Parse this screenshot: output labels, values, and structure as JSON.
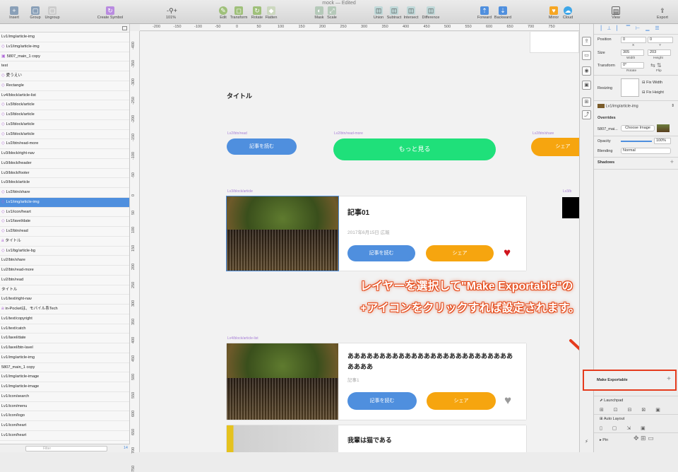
{
  "window": {
    "title": "mock",
    "status": "— Edited"
  },
  "toolbar": {
    "insert": "Insert",
    "group": "Group",
    "ungroup": "Ungroup",
    "create_symbol": "Create Symbol",
    "zoom": "101%",
    "edit": "Edit",
    "transform": "Transform",
    "rotate": "Rotate",
    "flatten": "Flatten",
    "mask": "Mask",
    "scale": "Scale",
    "union": "Union",
    "subtract": "Subtract",
    "intersect": "Intersect",
    "difference": "Difference",
    "forward": "Forward",
    "backward": "Backward",
    "mirror": "Mirror",
    "cloud": "Cloud",
    "view": "View",
    "export": "Export",
    "plus": "+",
    "minus": "-"
  },
  "ruler": {
    "top": [
      "-200",
      "-150",
      "-100",
      "-50",
      "0",
      "50",
      "100",
      "150",
      "200",
      "250",
      "300",
      "350",
      "400",
      "450",
      "500",
      "550",
      "600",
      "650",
      "700",
      "750"
    ],
    "left": [
      "-400",
      "-350",
      "-300",
      "-250",
      "-200",
      "-150",
      "-100",
      "-50",
      "0",
      "50",
      "100",
      "150",
      "200",
      "250",
      "300",
      "350",
      "400",
      "450",
      "500",
      "550",
      "600",
      "650",
      "700",
      "750"
    ]
  },
  "layers": [
    {
      "label": "Lv1/img/article-img",
      "mark": ""
    },
    {
      "label": "Lv1/img/article-img",
      "mark": "◇"
    },
    {
      "label": "5807_main_1 copy",
      "mark": "▣"
    },
    {
      "label": "test",
      "mark": ""
    },
    {
      "label": "愛うえい",
      "mark": "◇"
    },
    {
      "label": "Rectangle",
      "mark": "◇"
    },
    {
      "label": "Lv4/block/article-list",
      "mark": ""
    },
    {
      "label": "Lv3/block/article",
      "mark": "◇"
    },
    {
      "label": "Lv3/block/article",
      "mark": "◇"
    },
    {
      "label": "Lv3/block/article",
      "mark": "◇"
    },
    {
      "label": "Lv3/block/article",
      "mark": "◇"
    },
    {
      "label": "Lv2/btn/read-more",
      "mark": "◇"
    },
    {
      "label": "Lv3/block/right-nav",
      "mark": ""
    },
    {
      "label": "Lv3/block/header",
      "mark": ""
    },
    {
      "label": "Lv3/block/footer",
      "mark": ""
    },
    {
      "label": "Lv3/block/article",
      "mark": ""
    },
    {
      "label": "Lv2/btn/share",
      "mark": "◇"
    },
    {
      "label": "Lv1/img/article-img",
      "mark": "◇",
      "selected": true
    },
    {
      "label": "Lv1/icon/heart",
      "mark": "◇"
    },
    {
      "label": "Lv1/lavel/date",
      "mark": "◇"
    },
    {
      "label": "Lv2/btn/read",
      "mark": "◇"
    },
    {
      "label": "タイトル",
      "mark": "a"
    },
    {
      "label": "Lv1/bg/article-bg",
      "mark": "◇"
    },
    {
      "label": "Lv2/btn/share",
      "mark": ""
    },
    {
      "label": "Lv2/btn/read-more",
      "mark": ""
    },
    {
      "label": "Lv2/btn/read",
      "mark": ""
    },
    {
      "label": "タイトル",
      "mark": ""
    },
    {
      "label": "Lv1/text/right-nav",
      "mark": ""
    },
    {
      "label": "in-Pocketは、モバイル系Tech",
      "mark": "a"
    },
    {
      "label": "Lv1/text/copyright",
      "mark": ""
    },
    {
      "label": "Lv1/text/catch",
      "mark": ""
    },
    {
      "label": "Lv1/lavel/date",
      "mark": ""
    },
    {
      "label": "Lv1/lavel/btn-lavel",
      "mark": ""
    },
    {
      "label": "Lv1/img/article-img",
      "mark": ""
    },
    {
      "label": "5807_main_1 copy",
      "mark": ""
    },
    {
      "label": "Lv1/img/article-image",
      "mark": ""
    },
    {
      "label": "Lv1/img/article-image",
      "mark": ""
    },
    {
      "label": "Lv1/icon/search",
      "mark": ""
    },
    {
      "label": "Lv1/icon/menu",
      "mark": ""
    },
    {
      "label": "Lv1/icon/logo",
      "mark": ""
    },
    {
      "label": "Lv1/icon/heart",
      "mark": ""
    },
    {
      "label": "Lv1/icon/heart",
      "mark": ""
    }
  ],
  "sidebar_footer": {
    "filter_placeholder": "Filter",
    "count": "14"
  },
  "canvas": {
    "title": "タイトル",
    "labels": {
      "read": "Lv2/btn/read",
      "read_more": "Lv2/btn/read-more",
      "share": "Lv2/btn/share",
      "article": "Lv3/block/article",
      "article_list": "Lv4/block/article-list",
      "right_cut": "Lv3/b"
    },
    "buttons": {
      "read": "記事を読む",
      "more": "もっと見る",
      "share": "シェア"
    },
    "article1": {
      "title": "記事01",
      "meta": "2017年6月15日 広報",
      "read": "記事を読む",
      "share": "シェア",
      "heart": "♥"
    },
    "article2": {
      "title": "ああああああああああああああああああああああああああああああ",
      "meta": "記事1",
      "read": "記事を読む",
      "share": "シェア",
      "heart": "♥"
    },
    "article3": {
      "title": "我輩は猫である"
    },
    "annotation": {
      "line1": "レイヤーを選択して\"Make Exportable\"の",
      "line2": "+アイコンをクリックすれば設定されます。"
    }
  },
  "inspector": {
    "position_label": "Position",
    "x": "0",
    "y": "0",
    "x_label": "X",
    "y_label": "Y",
    "size_label": "Size",
    "width": "305",
    "height": "203",
    "width_label": "Width",
    "height_label": "Height",
    "transform_label": "Transform",
    "rotate": "0°",
    "rotate_label": "Rotate",
    "flip_label": "Flip",
    "resizing_label": "Resizing",
    "fix_width": "Fix Width",
    "fix_height": "Fix Height",
    "symbol": "Lv1/img/article-img",
    "overrides": "Overrides",
    "override_name": "5807_mai...",
    "choose_image": "Choose Image",
    "opacity_label": "Opacity",
    "opacity": "100%",
    "blending_label": "Blending",
    "blending": "Normal",
    "shadows": "Shadows",
    "make_exportable": "Make Exportable",
    "plus": "+",
    "plugins": [
      "Anima",
      "Launchpad",
      "Auto Layout",
      "Pin"
    ]
  },
  "colors": {
    "blue": "#4f8fde",
    "green": "#1fe07a",
    "orange": "#f6a50f",
    "heart_red": "#d0131c",
    "heart_gray": "#9a9a9a",
    "annotation": "#e54c1c",
    "select": "#4f8fde"
  }
}
